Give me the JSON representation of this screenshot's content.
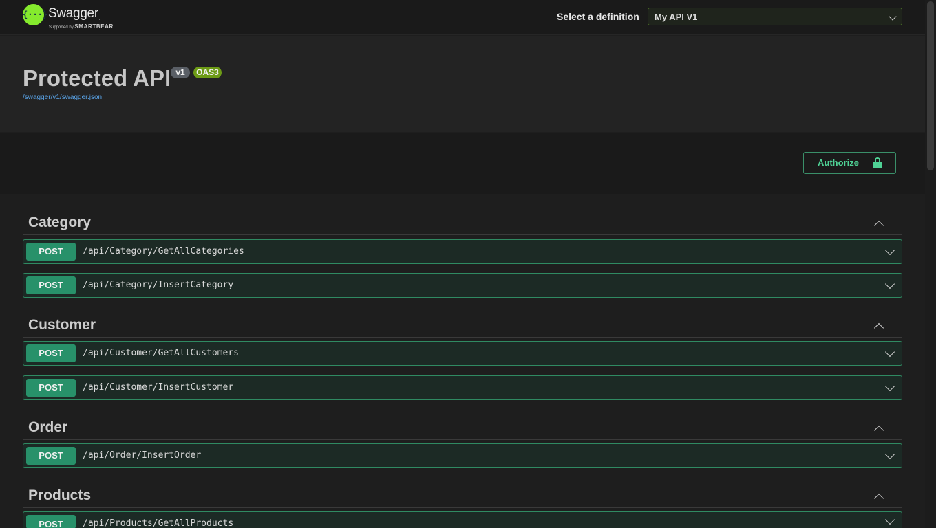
{
  "topbar": {
    "logo_name": "Swagger",
    "logo_tm": ".",
    "logo_sub_prefix": "Supported by",
    "logo_sub_brand": "SMARTBEAR",
    "definition_label": "Select a definition",
    "definition_value": "My API V1"
  },
  "info": {
    "title": "Protected API",
    "version": "v1",
    "oas": "OAS3",
    "spec_url": "/swagger/v1/swagger.json"
  },
  "auth": {
    "label": "Authorize"
  },
  "tags": [
    {
      "name": "Category",
      "operations": [
        {
          "method": "POST",
          "path": "/api/Category/GetAllCategories"
        },
        {
          "method": "POST",
          "path": "/api/Category/InsertCategory"
        }
      ]
    },
    {
      "name": "Customer",
      "operations": [
        {
          "method": "POST",
          "path": "/api/Customer/GetAllCustomers"
        },
        {
          "method": "POST",
          "path": "/api/Customer/InsertCustomer"
        }
      ]
    },
    {
      "name": "Order",
      "operations": [
        {
          "method": "POST",
          "path": "/api/Order/InsertOrder"
        }
      ]
    },
    {
      "name": "Products",
      "operations": [
        {
          "method": "POST",
          "path": "/api/Products/GetAllProducts"
        }
      ]
    }
  ],
  "colors": {
    "post": "#49cc90",
    "accent": "#85ea2d"
  },
  "icons": [
    "swagger-logo-icon",
    "chevron-down-icon",
    "chevron-up-icon",
    "lock-icon"
  ]
}
